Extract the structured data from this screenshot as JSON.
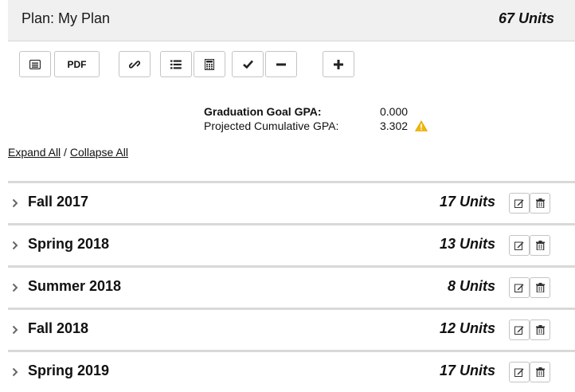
{
  "plan": {
    "title": "Plan: My Plan",
    "total_units": "67 Units"
  },
  "toolbar": {
    "pdf_label": "PDF",
    "buttons": [
      "notes-icon",
      "pdf",
      "link-icon",
      "list-icon",
      "calculator-icon",
      "checkmark-icon",
      "minus-icon",
      "plus-icon"
    ]
  },
  "gpa": {
    "goal_label": "Graduation Goal GPA:",
    "goal_value": "0.000",
    "projected_label": "Projected Cumulative GPA:",
    "projected_value": "3.302",
    "warning_color": "#f2b705"
  },
  "links": {
    "expand_all": "Expand All",
    "separator": " / ",
    "collapse_all": "Collapse All"
  },
  "terms": [
    {
      "name": "Fall 2017",
      "units": "17 Units"
    },
    {
      "name": "Spring 2018",
      "units": "13 Units"
    },
    {
      "name": "Summer 2018",
      "units": "8 Units"
    },
    {
      "name": "Fall 2018",
      "units": "12 Units"
    },
    {
      "name": "Spring 2019",
      "units": "17 Units"
    }
  ]
}
